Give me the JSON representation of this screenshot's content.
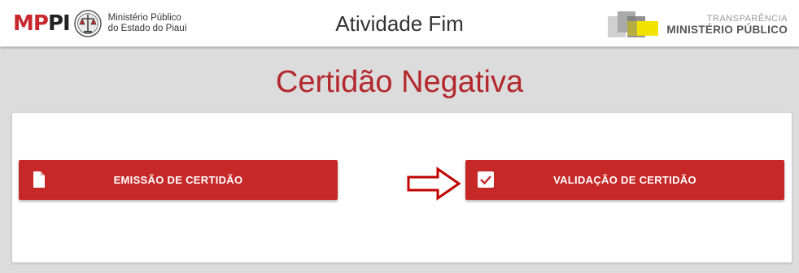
{
  "header": {
    "brand_mp": "MP",
    "brand_pi": "PI",
    "brand_line1": "Ministério Público",
    "brand_line2": "do Estado do Piauí",
    "title": "Atividade Fim",
    "transparency_top": "TRANSPARÊNCIA",
    "transparency_bottom": "MINISTÉRIO PÚBLICO"
  },
  "page": {
    "title": "Certidão Negativa"
  },
  "buttons": {
    "emissao": {
      "label": "EMISSÃO DE CERTIDÃO",
      "icon": "document-icon"
    },
    "validacao": {
      "label": "VALIDAÇÃO DE CERTIDÃO",
      "icon": "checkbox-icon"
    }
  },
  "annotation": {
    "icon": "arrow-right-icon",
    "color": "#c00000"
  },
  "colors": {
    "accent": "#c62828",
    "title": "#b3272d",
    "background": "#dcdcdc"
  }
}
